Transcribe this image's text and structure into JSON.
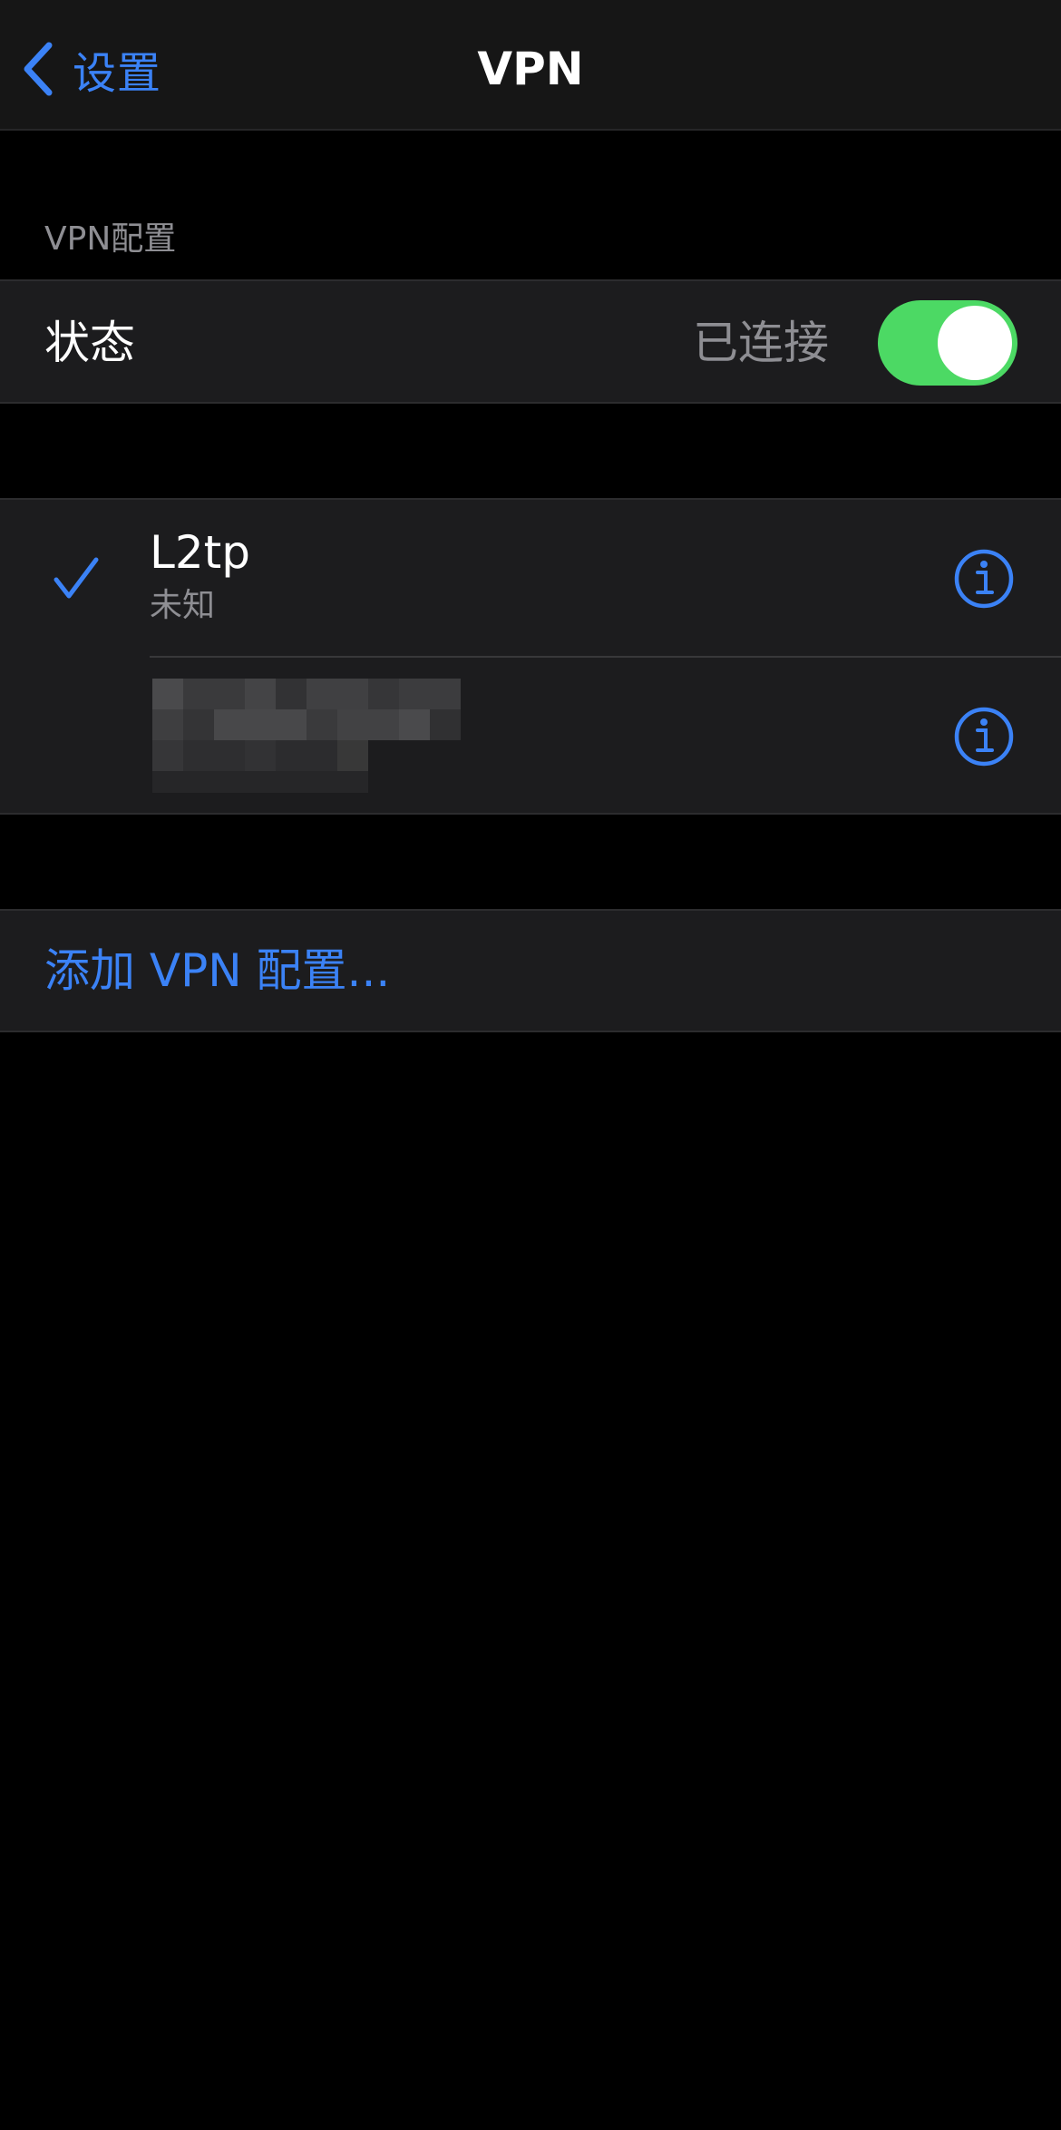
{
  "navbar": {
    "back_label": "设置",
    "title": "VPN"
  },
  "section_header": "VPN配置",
  "status": {
    "label": "状态",
    "value": "已连接",
    "toggle_on": true
  },
  "vpn_configs": [
    {
      "name": "L2tp",
      "subtitle": "未知",
      "selected": true
    },
    {
      "name": "",
      "subtitle": "",
      "selected": false,
      "redacted": true
    }
  ],
  "add_config_label": "添加 VPN 配置...",
  "colors": {
    "accent": "#3b82f6",
    "toggle_on": "#4cd964",
    "background": "#000000",
    "cell": "#1c1c1e",
    "secondary_text": "#8e8e93"
  },
  "icons": {
    "back": "chevron-left-icon",
    "selected": "checkmark-icon",
    "info": "info-circle-icon"
  }
}
